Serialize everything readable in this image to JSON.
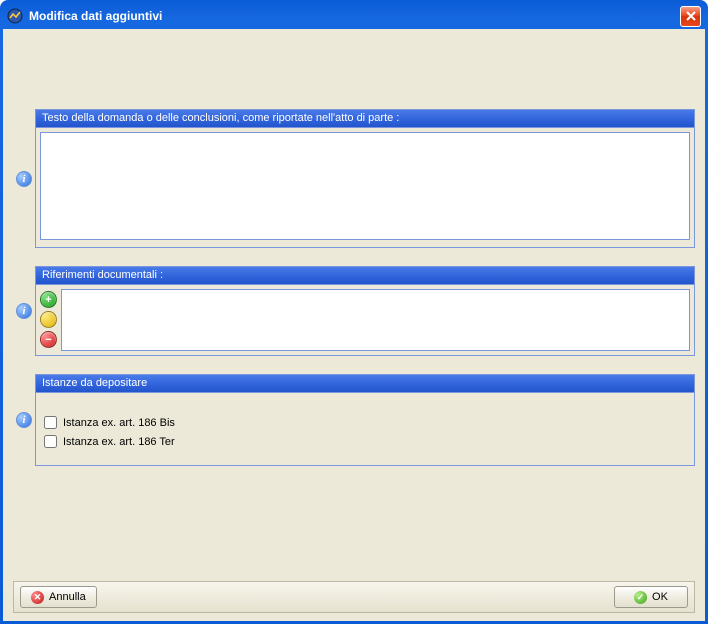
{
  "window": {
    "title": "Modifica dati aggiuntivi"
  },
  "sections": {
    "testo": {
      "header": "Testo della domanda o delle conclusioni, come riportate nell'atto di parte :",
      "value": ""
    },
    "riferimenti": {
      "header": "Riferimenti documentali :"
    },
    "istanze": {
      "header": "Istanze da depositare",
      "items": [
        {
          "label": "Istanza ex. art. 186 Bis",
          "checked": false
        },
        {
          "label": "Istanza ex. art. 186 Ter",
          "checked": false
        }
      ]
    }
  },
  "buttons": {
    "cancel": "Annulla",
    "ok": "OK"
  },
  "icons": {
    "info": "i",
    "add": "+",
    "remove": "−",
    "close": "✕",
    "check": "✓",
    "cross": "✕"
  }
}
